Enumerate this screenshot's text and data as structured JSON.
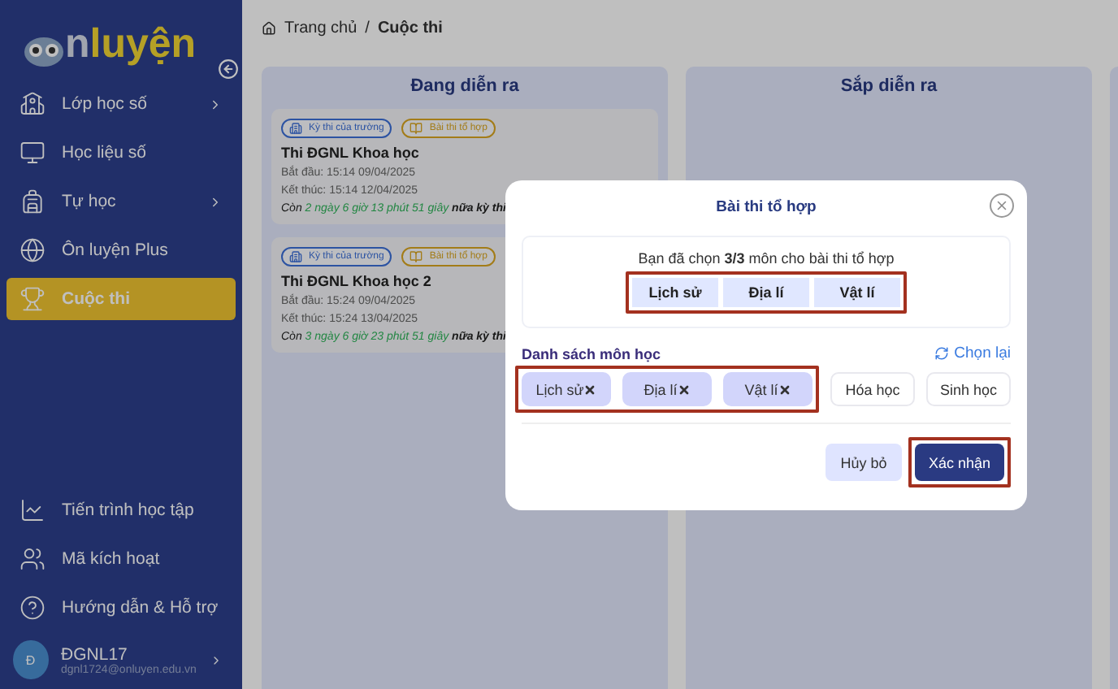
{
  "sidebar": {
    "logo": {
      "part_1": "n",
      "part_2": "luyện"
    },
    "items": [
      {
        "label": "Lớp học số",
        "has_submenu": true,
        "selected": false
      },
      {
        "label": "Học liệu số",
        "has_submenu": false,
        "selected": false
      },
      {
        "label": "Tự học",
        "has_submenu": true,
        "selected": false
      },
      {
        "label": "Ôn luyện Plus",
        "has_submenu": false,
        "selected": false
      },
      {
        "label": "Cuộc thi",
        "has_submenu": false,
        "selected": true
      }
    ],
    "bottom_items": [
      {
        "label": "Tiến trình học tập"
      },
      {
        "label": "Mã kích hoạt"
      },
      {
        "label": "Hướng dẫn & Hỗ trợ"
      }
    ],
    "user": {
      "avatar": "Đ",
      "name": "ĐGNL17",
      "email": "dgnl1724@onluyen.edu.vn"
    }
  },
  "breadcrumb": [
    "Trang chủ",
    "Cuộc thi"
  ],
  "breadcrumb_separator": "/",
  "columns": [
    {
      "kind": "full",
      "title": "Đang diễn ra",
      "cards": [
        {
          "tags": [
            {
              "label": "Kỳ thi của trường",
              "color": "#2c53a2"
            },
            {
              "label": "Bài thi tổ hợp",
              "color": "#a37c18"
            }
          ],
          "name": "Thi ĐGNL Khoa học",
          "start": "Bắt đầu: 15:14 09/04/2025",
          "end": "Kết thúc: 15:14 12/04/2025",
          "countdown": {
            "before": "Còn",
            "time": "2 ngày 6 giờ 13 phút 51 giây",
            "after": "nữa kỳ thi"
          }
        },
        {
          "tags": [
            {
              "label": "Kỳ thi của trường",
              "color": "#2c53a2"
            },
            {
              "label": "Bài thi tổ hợp",
              "color": "#a37c18"
            }
          ],
          "name": "Thi ĐGNL Khoa học 2",
          "start": "Bắt đầu: 15:24 09/04/2025",
          "end": "Kết thúc: 15:24 13/04/2025",
          "countdown": {
            "before": "Còn",
            "time": "3 ngày 6 giờ 23 phút 51 giây",
            "after": "nữa kỳ thi"
          }
        }
      ]
    },
    {
      "kind": "full",
      "title": "Sắp diễn ra"
    },
    {
      "kind": "cut"
    }
  ],
  "modal": {
    "title": "Bài thi tổ hợp",
    "summary": "Bạn đã chọn **3/3** môn cho bài thi tổ hợp",
    "chosen": [
      "Lịch sử",
      "Địa lí",
      "Vật lí"
    ],
    "chosen_highlighted": true,
    "list_title": "Danh sách môn học",
    "reset": "Chọn lại",
    "subjects_highlighted": true,
    "subjects": [
      {
        "label": "Lịch sử",
        "selected": true
      },
      {
        "label": "Địa lí",
        "selected": true
      },
      {
        "label": "Vật lí",
        "selected": true
      },
      {
        "label": "Hóa học",
        "selected": false
      },
      {
        "label": "Sinh học",
        "selected": false
      }
    ],
    "cancel": "Hủy bỏ",
    "confirm": "Xác nhận",
    "confirm_highlighted": true
  }
}
